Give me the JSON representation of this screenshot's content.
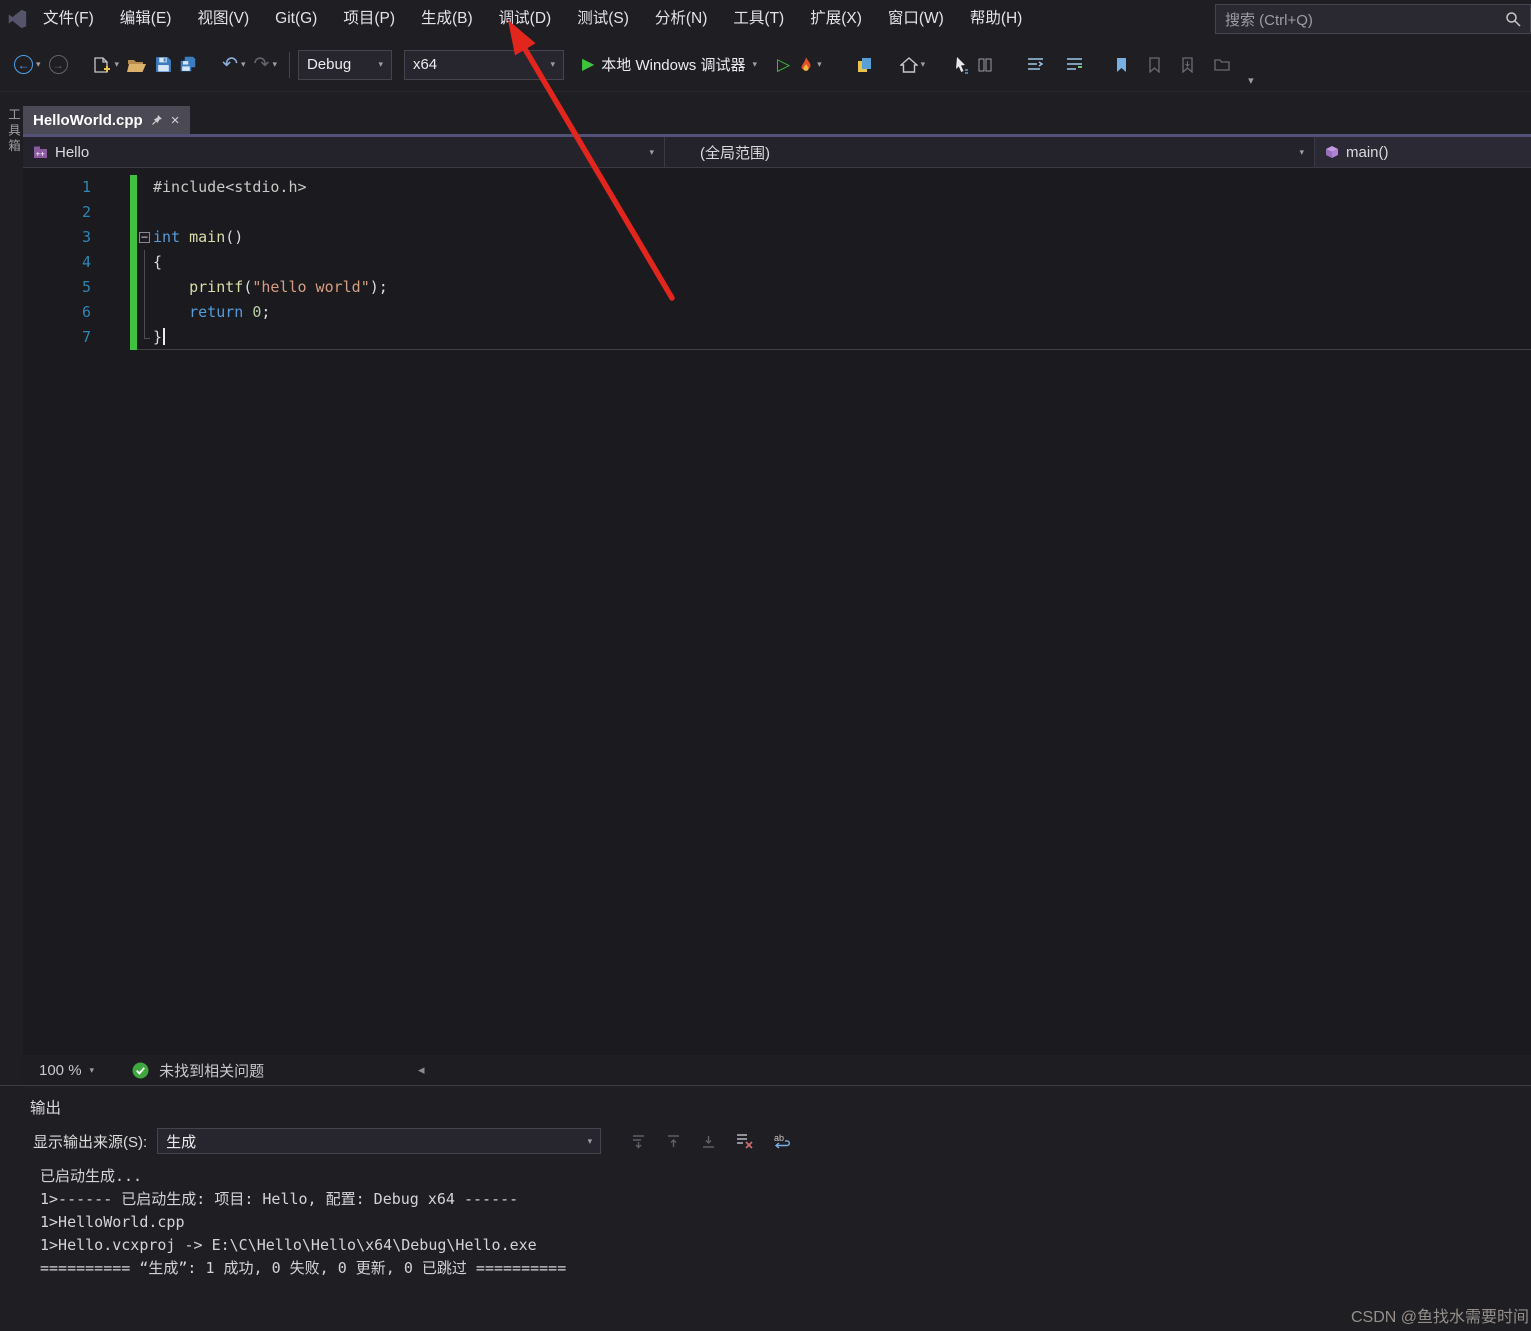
{
  "colors": {
    "accent_purple": "#535178",
    "run_green": "#3ec43e",
    "arrow_red": "#e3261d",
    "line_number_blue": "#2f86b3",
    "change_bar_green": "#3fc23f",
    "string_orange": "#d69d85",
    "keyword_blue": "#569cd6"
  },
  "menubar": {
    "items": [
      "文件(F)",
      "编辑(E)",
      "视图(V)",
      "Git(G)",
      "项目(P)",
      "生成(B)",
      "调试(D)",
      "测试(S)",
      "分析(N)",
      "工具(T)",
      "扩展(X)",
      "窗口(W)",
      "帮助(H)"
    ],
    "search_placeholder": "搜索 (Ctrl+Q)"
  },
  "toolbar": {
    "configuration": "Debug",
    "platform": "x64",
    "debugger_label": "本地 Windows 调试器",
    "buttons": [
      "navigate-back",
      "navigate-forward",
      "new-file",
      "open-folder",
      "save",
      "save-all",
      "undo",
      "redo",
      "configuration-select",
      "platform-select",
      "start-debugging",
      "start-without-debugging",
      "hot-reload",
      "documents",
      "browser-link",
      "pointer",
      "split-columns",
      "indent-lines",
      "comment-lines",
      "bookmark",
      "previous-bookmark",
      "next-bookmark",
      "bookmark-folder",
      "toolbar-overflow"
    ]
  },
  "side": {
    "toolbox_label": "工具箱"
  },
  "editor": {
    "tab_title": "HelloWorld.cpp",
    "nav": {
      "project": "Hello",
      "scope": "(全局范围)",
      "member": "main()"
    },
    "code_lines": [
      {
        "n": 1,
        "fold": "",
        "tokens": [
          {
            "c": "pp",
            "t": "#include<stdio.h>"
          }
        ]
      },
      {
        "n": 2,
        "fold": "",
        "tokens": []
      },
      {
        "n": 3,
        "fold": "open",
        "tokens": [
          {
            "c": "kw",
            "t": "int"
          },
          {
            "c": "plain",
            "t": " "
          },
          {
            "c": "fn",
            "t": "main"
          },
          {
            "c": "plain",
            "t": "()"
          }
        ]
      },
      {
        "n": 4,
        "fold": "guide",
        "tokens": [
          {
            "c": "plain",
            "t": "{"
          }
        ]
      },
      {
        "n": 5,
        "fold": "guide",
        "tokens": [
          {
            "c": "plain",
            "t": "    "
          },
          {
            "c": "fn",
            "t": "printf"
          },
          {
            "c": "plain",
            "t": "("
          },
          {
            "c": "str",
            "t": "\"hello world\""
          },
          {
            "c": "plain",
            "t": ")"
          },
          {
            "c": "plain",
            "t": ";"
          }
        ]
      },
      {
        "n": 6,
        "fold": "guide",
        "tokens": [
          {
            "c": "plain",
            "t": "    "
          },
          {
            "c": "kw",
            "t": "return"
          },
          {
            "c": "plain",
            "t": " "
          },
          {
            "c": "num",
            "t": "0"
          },
          {
            "c": "plain",
            "t": ";"
          }
        ]
      },
      {
        "n": 7,
        "fold": "close",
        "current": true,
        "caret": true,
        "tokens": [
          {
            "c": "plain",
            "t": "}"
          }
        ]
      }
    ],
    "zoom": "100 %",
    "status_message": "未找到相关问题"
  },
  "output": {
    "title": "输出",
    "source_label": "显示输出来源(S):",
    "source_value": "生成",
    "toolbar_icons": [
      "goto-message",
      "previous-message",
      "next-message",
      "clear-all",
      "word-wrap"
    ],
    "lines": [
      "已启动生成...",
      "1>------ 已启动生成: 项目: Hello, 配置: Debug x64 ------",
      "1>HelloWorld.cpp",
      "1>Hello.vcxproj -> E:\\C\\Hello\\Hello\\x64\\Debug\\Hello.exe",
      "========== “生成”: 1 成功, 0 失败, 0 更新, 0 已跳过 =========="
    ]
  },
  "watermark": "CSDN @鱼找水需要时间"
}
